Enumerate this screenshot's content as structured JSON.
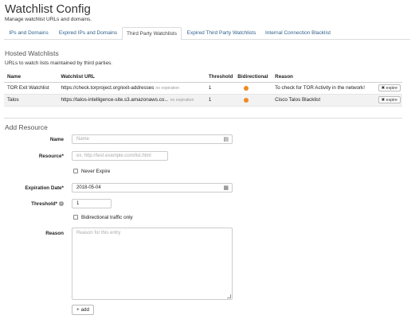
{
  "page": {
    "title": "Watchlist Config",
    "subtitle": "Manage watchlist URLs and domains."
  },
  "tabs": [
    {
      "label": "IPs and Domains"
    },
    {
      "label": "Expired IPs and Domains"
    },
    {
      "label": "Third Party Watchlists",
      "active": true
    },
    {
      "label": "Expired Third Party Watchlists"
    },
    {
      "label": "Internal Connection Blacklist"
    }
  ],
  "hosted": {
    "title": "Hosted Watchlists",
    "description": "URLs to watch lists maintained by third parties.",
    "columns": [
      "Name",
      "Watchlist URL",
      "Threshold",
      "Bidirectional",
      "Reason"
    ],
    "rows": [
      {
        "name": "TOR Exit Watchlist",
        "url": "https://check.torproject.org/exit-addresses",
        "expiration": "no expiration",
        "threshold": "1",
        "bidirectional": true,
        "reason": "To check for TOR Activity in the network!",
        "expire_label": "expire"
      },
      {
        "name": "Talos",
        "url": "https://talos-intelligence-site.s3.amazonaws.co...",
        "expiration": "no expiration",
        "threshold": "1",
        "bidirectional": true,
        "reason": "Cisco Talos Blacklist",
        "expire_label": "expire"
      }
    ],
    "status_color": "#f08a24"
  },
  "add_resource": {
    "title": "Add Resource",
    "name_label": "Name",
    "name_placeholder": "Name",
    "resource_label": "Resource*",
    "resource_placeholder": "ex. http://test.example.com/list.html",
    "never_expire_label": "Never Expire",
    "expiration_label": "Expiration Date*",
    "expiration_value": "2018-05-04",
    "threshold_label": "Threshold*",
    "threshold_value": "1",
    "bidirectional_label": "Bidirectional traffic only",
    "reason_label": "Reason",
    "reason_placeholder": "Reason for this entry",
    "add_button_label": "add"
  },
  "colors": {
    "link": "#2f5f8a",
    "accent_dot": "#f08a24"
  }
}
